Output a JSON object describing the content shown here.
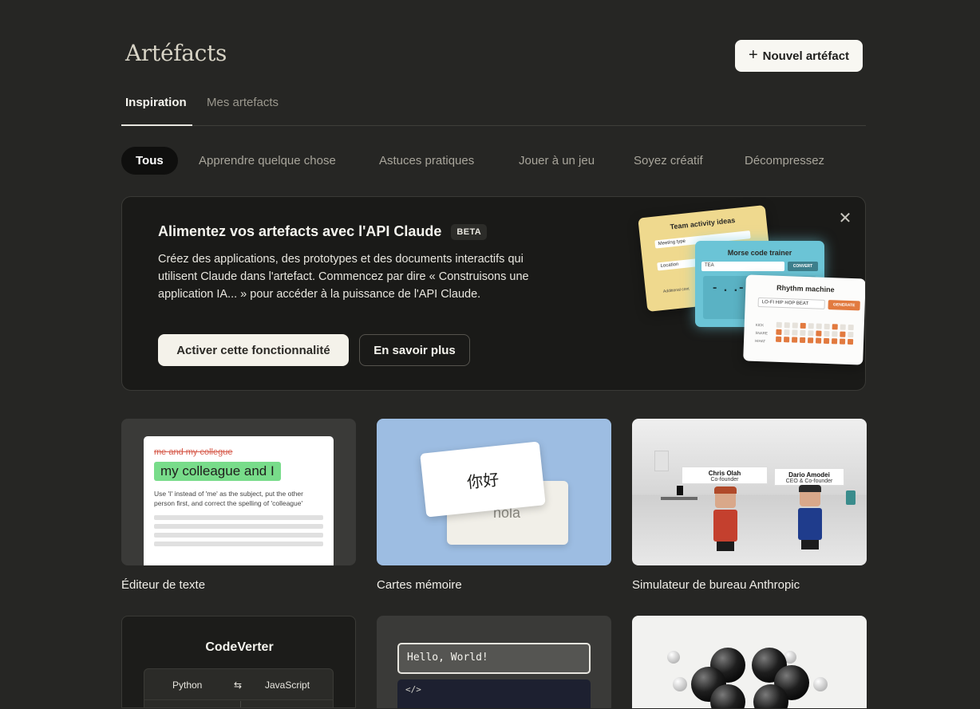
{
  "header": {
    "title": "Artéfacts",
    "new_button": "Nouvel artéfact",
    "new_icon": "plus-icon"
  },
  "tabs": [
    {
      "label": "Inspiration",
      "active": true
    },
    {
      "label": "Mes artefacts",
      "active": false
    }
  ],
  "filters": [
    {
      "label": "Tous",
      "active": true
    },
    {
      "label": "Apprendre quelque chose"
    },
    {
      "label": "Astuces pratiques"
    },
    {
      "label": "Jouer à un jeu"
    },
    {
      "label": "Soyez créatif"
    },
    {
      "label": "Décompressez"
    }
  ],
  "banner": {
    "title": "Alimentez vos artefacts avec l'API Claude",
    "badge": "BETA",
    "description": "Créez des applications, des prototypes et des documents interactifs qui utilisent Claude dans l'artefact. Commencez par dire « Construisons une application IA... » pour accéder à la puissance de l'API Claude.",
    "primary_button": "Activer cette fonctionnalité",
    "secondary_button": "En savoir plus",
    "close_icon": "close-icon",
    "preview": {
      "yellow_title": "Team activity ideas",
      "yellow_field1": "Meeting type",
      "yellow_field2": "Location",
      "yellow_field3": "Additional cont",
      "teal_title": "Morse code trainer",
      "teal_input": "TEA",
      "teal_button": "CONVERT",
      "teal_morse": "- . .-",
      "white_title": "Rhythm machine",
      "white_input": "LO-FI HIP HOP BEAT",
      "white_button": "GENERATE",
      "rows": [
        "KICK",
        "SNARE",
        "HIHAT"
      ]
    }
  },
  "cards": [
    {
      "label": "Éditeur de texte",
      "strike": "me and my collegue",
      "highlight": "my colleague and I",
      "note": "Use 'I' instead of 'me' as the subject, put the other person first, and correct the spelling of 'colleague'"
    },
    {
      "label": "Cartes mémoire",
      "front": "你好",
      "back": "hola"
    },
    {
      "label": "Simulateur de bureau Anthropic",
      "person1_name": "Chris Olah",
      "person1_role": "Co-founder",
      "person2_name": "Dario Amodei",
      "person2_role": "CEO & Co-founder"
    },
    {
      "title": "CodeVerter",
      "lang_from": "Python",
      "swap_icon": "swap-arrows-icon",
      "lang_to": "JavaScript"
    },
    {
      "input": "Hello, World!",
      "code": "</>"
    },
    {
      "subject": "molecule-3d"
    }
  ],
  "colors": {
    "background": "#262624",
    "accent_orange": "#e27a3f",
    "flashcard_bg": "#9dbde2",
    "highlight_green": "#78dc8a"
  }
}
